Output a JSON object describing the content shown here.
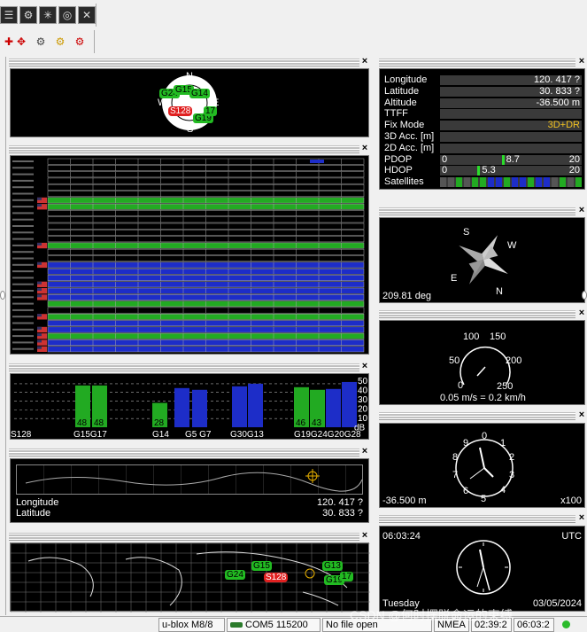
{
  "toolbar": {
    "row1_icons": [
      "list-icon",
      "config-icon",
      "satellite-icon",
      "globe-icon",
      "chart-icon"
    ],
    "row2_icons": [
      "plug-icon",
      "move-icon",
      "gear-settings-icon",
      "gear-yellow-icon",
      "gear-red-icon"
    ]
  },
  "compass_sky": {
    "dirs": {
      "n": "N",
      "s": "S",
      "e": "E",
      "w": "W"
    },
    "sats": [
      "G24",
      "G15",
      "G14",
      "S128",
      "G19",
      "17"
    ]
  },
  "nav": {
    "labels": [
      "Longitude",
      "Latitude",
      "Altitude",
      "TTFF",
      "Fix Mode",
      "3D Acc. [m]",
      "2D Acc. [m]",
      "PDOP",
      "HDOP",
      "Satellites"
    ],
    "longitude": "120.      417 ?",
    "latitude": "30.      833 ?",
    "altitude": "-36.500 m",
    "fix_mode": "3D+DR",
    "pdop": {
      "min": "0",
      "val": "8.7",
      "max": "20",
      "level": 0.435
    },
    "hdop": {
      "min": "0",
      "val": "5.3",
      "max": "20",
      "level": 0.265
    }
  },
  "heading": {
    "value": "209.81 deg",
    "dirs": {
      "s": "S",
      "w": "W",
      "e": "E",
      "n": "N"
    }
  },
  "speed": {
    "ticks": [
      "0",
      "50",
      "100",
      "150",
      "200",
      "250"
    ],
    "text": "0.05 m/s = 0.2 km/h"
  },
  "altimeter": {
    "ticks": [
      "0",
      "1",
      "2",
      "3",
      "4",
      "5",
      "6",
      "7",
      "8",
      "9"
    ],
    "value": "-36.500 m",
    "mult": "x100"
  },
  "clock": {
    "time": "06:03:24",
    "zone": "UTC",
    "day": "Tuesday",
    "date": "03/05/2024"
  },
  "cn_chart": {
    "y_ticks": [
      "50",
      "40",
      "30",
      "20",
      "10",
      "dB"
    ],
    "bars": [
      {
        "label": "S128",
        "value": 0,
        "color": "#22aa22"
      },
      {
        "label": "G15",
        "value": 48,
        "color": "#22aa22",
        "shown": "48"
      },
      {
        "label": "G17",
        "value": 48,
        "color": "#22aa22",
        "shown": "48"
      },
      {
        "label": "G14",
        "value": 28,
        "color": "#22aa22",
        "shown": "28"
      },
      {
        "label": "G5",
        "value": 45,
        "color": "#1d2dc8"
      },
      {
        "label": "G7",
        "value": 43,
        "color": "#1d2dc8"
      },
      {
        "label": "G30",
        "value": 47,
        "color": "#1d2dc8"
      },
      {
        "label": "G13",
        "value": 50,
        "color": "#1d2dc8"
      },
      {
        "label": "G19",
        "value": 46,
        "color": "#22aa22",
        "shown": "46"
      },
      {
        "label": "G24",
        "value": 43,
        "color": "#22aa22",
        "shown": "43"
      },
      {
        "label": "G20",
        "value": 44,
        "color": "#1d2dc8"
      },
      {
        "label": "G28",
        "value": 52,
        "color": "#1d2dc8"
      }
    ],
    "x_labels": [
      "S128",
      "G15G17",
      "G14",
      "G5 G7",
      "G30G13",
      "G19G24G20G28"
    ]
  },
  "worldmap1": {
    "lon_label": "Longitude",
    "lat_label": "Latitude",
    "lon": "120.      417 ?",
    "lat": "30.      833 ?"
  },
  "worldmap2": {
    "sats": [
      "G24",
      "G15",
      "S128",
      "G13",
      "G19",
      "17"
    ]
  },
  "status": {
    "receiver": "u-blox M8/8",
    "port": "COM5 115200",
    "file": "No file open",
    "protocol": "NMEA",
    "t1": "02:39:2",
    "t2": "06:03:2",
    "watermark": "CSDN @何时摆脱命运的束缚"
  }
}
